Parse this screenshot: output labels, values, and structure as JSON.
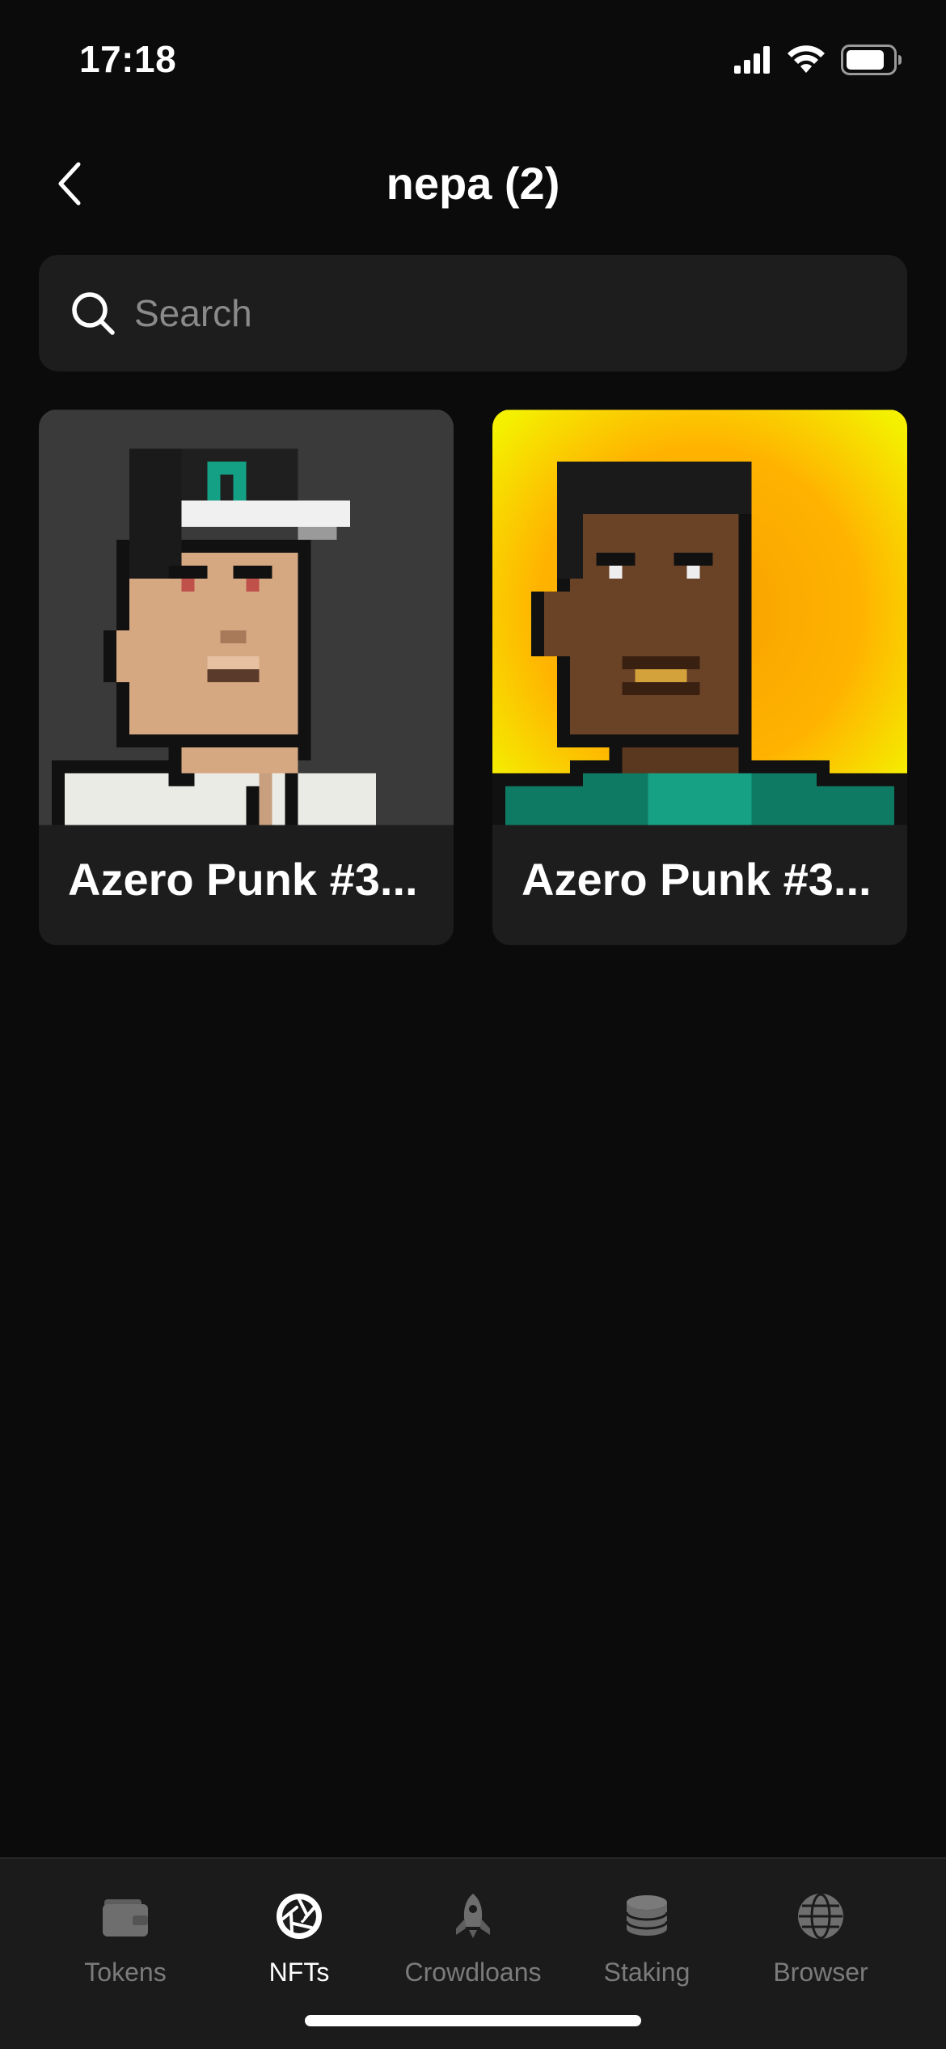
{
  "status_bar": {
    "time": "17:18"
  },
  "header": {
    "title": "nepa (2)"
  },
  "search": {
    "placeholder": "Search",
    "value": ""
  },
  "nfts": [
    {
      "name": "Azero Punk #3..."
    },
    {
      "name": "Azero Punk #3..."
    }
  ],
  "tabs": [
    {
      "label": "Tokens",
      "icon": "wallet-icon",
      "active": false
    },
    {
      "label": "NFTs",
      "icon": "aperture-icon",
      "active": true
    },
    {
      "label": "Crowdloans",
      "icon": "rocket-icon",
      "active": false
    },
    {
      "label": "Staking",
      "icon": "coin-stack-icon",
      "active": false
    },
    {
      "label": "Browser",
      "icon": "globe-icon",
      "active": false
    }
  ],
  "colors": {
    "background": "#0b0b0b",
    "surface": "#1d1d1d",
    "text_primary": "#ffffff",
    "text_muted": "#7b7b7b",
    "accent_teal": "#13a085"
  }
}
